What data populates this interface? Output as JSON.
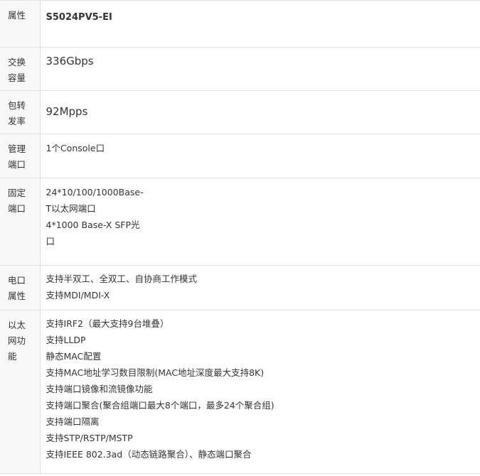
{
  "rows": [
    {
      "key": [
        "属性"
      ],
      "values": [
        "S5024PV5-EI"
      ]
    },
    {
      "key": [
        "交换",
        "容量"
      ],
      "values": [
        "336Gbps"
      ]
    },
    {
      "key": [
        "包转",
        "发率"
      ],
      "values": [
        "92Mpps"
      ]
    },
    {
      "key": [
        "管理",
        "端口"
      ],
      "values": [
        "1个Console口"
      ]
    },
    {
      "key": [
        "固定",
        "端口"
      ],
      "values": [
        "24*10/100/1000Base-",
        "T以太网端口",
        "4*1000 Base-X SFP光",
        "口"
      ]
    },
    {
      "key": [
        "电口",
        "属性"
      ],
      "values": [
        "支持半双工、全双工、自协商工作模式",
        "支持MDI/MDI-X"
      ]
    },
    {
      "key": [
        "以太",
        "网功",
        "能"
      ],
      "values": [
        "支持IRF2（最大支持9台堆叠）",
        "支持LLDP",
        "静态MAC配置",
        "支持MAC地址学习数目限制(MAC地址深度最大支持8K)",
        "支持端口镜像和流镜像功能",
        "支持端口聚合(聚合组端口最大8个端口，最多24个聚合组)",
        "支持端口隔离",
        "支持STP/RSTP/MSTP",
        "支持IEEE 802.3ad（动态链路聚合）、静态端口聚合"
      ]
    }
  ]
}
